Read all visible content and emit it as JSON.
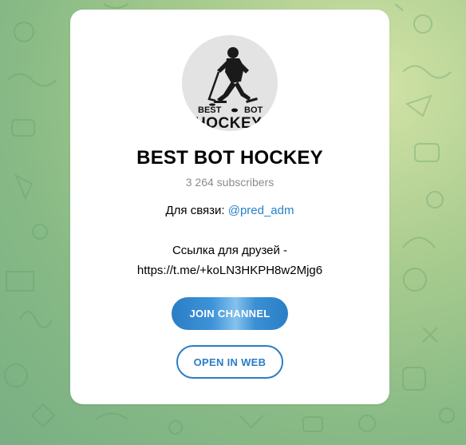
{
  "channel": {
    "title": "BEST BOT HOCKEY",
    "subscribers": "3 264 subscribers",
    "avatar": {
      "text_top_left": "BEST",
      "text_top_right": "BOT",
      "text_bottom": "HOCKEY"
    }
  },
  "description": {
    "contact_label": "Для связи: ",
    "contact_handle": "@pred_adm",
    "friends_label": "Ссылка для друзей -",
    "friends_link": "https://t.me/+koLN3HKPH8w2Mjg6"
  },
  "buttons": {
    "join_label": "JOIN CHANNEL",
    "web_label": "OPEN IN WEB"
  },
  "colors": {
    "accent": "#2a7ec6",
    "link": "#2481cc",
    "muted": "#8c8c8c"
  }
}
